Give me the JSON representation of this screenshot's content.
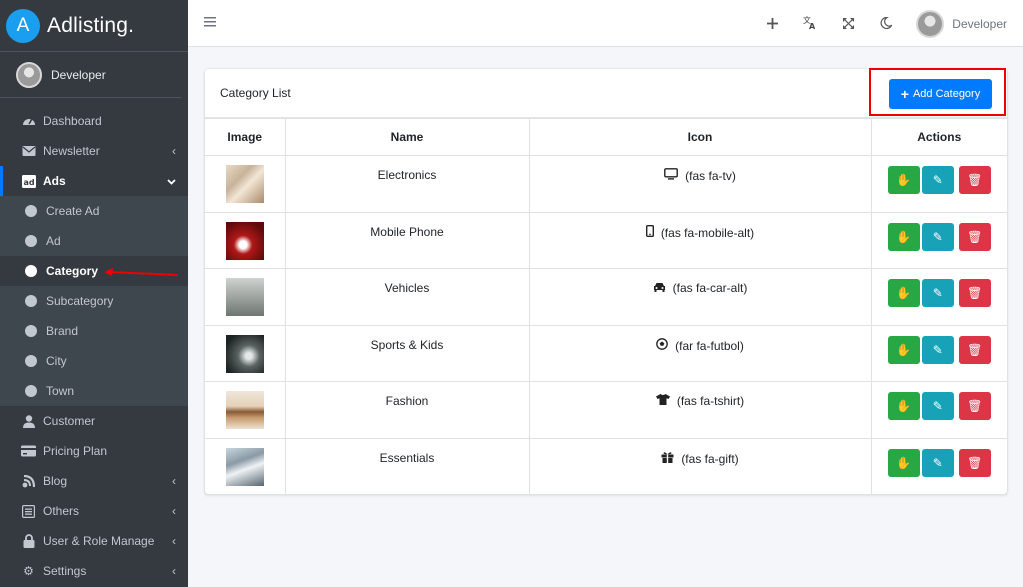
{
  "brand": {
    "logo_letter": "A",
    "name": "Adlisting."
  },
  "user": {
    "name": "Developer"
  },
  "sidebar": {
    "items": [
      {
        "label": "Dashboard",
        "icon": "tachometer-icon"
      },
      {
        "label": "Newsletter",
        "icon": "envelope-icon"
      },
      {
        "label": "Ads",
        "icon": "ad-icon"
      },
      {
        "label": "Customer",
        "icon": "user-icon"
      },
      {
        "label": "Pricing Plan",
        "icon": "credit-card-icon"
      },
      {
        "label": "Blog",
        "icon": "blog-icon"
      },
      {
        "label": "Others",
        "icon": "list-icon"
      },
      {
        "label": "User & Role Manage",
        "icon": "lock-icon"
      },
      {
        "label": "Settings",
        "icon": "cog-icon"
      }
    ],
    "ads_submenu": [
      "Create Ad",
      "Ad",
      "Category",
      "Subcategory",
      "Brand",
      "City",
      "Town"
    ],
    "active_item": "Category"
  },
  "topbar": {
    "user_name": "Developer"
  },
  "card": {
    "title": "Category List",
    "add_button_label": "Add Category"
  },
  "table": {
    "headers": [
      "Image",
      "Name",
      "Icon",
      "Actions"
    ],
    "rows": [
      {
        "name": "Electronics",
        "icon_class": "(fas fa-tv)",
        "icon": "tv-icon"
      },
      {
        "name": "Mobile Phone",
        "icon_class": "(fas fa-mobile-alt)",
        "icon": "mobile-icon"
      },
      {
        "name": "Vehicles",
        "icon_class": "(fas fa-car-alt)",
        "icon": "car-icon"
      },
      {
        "name": "Sports & Kids",
        "icon_class": "(far fa-futbol)",
        "icon": "futbol-icon"
      },
      {
        "name": "Fashion",
        "icon_class": "(fas fa-tshirt)",
        "icon": "tshirt-icon"
      },
      {
        "name": "Essentials",
        "icon_class": "(fas fa-gift)",
        "icon": "gift-icon"
      }
    ]
  },
  "colors": {
    "sidebar_bg": "#343a40",
    "primary": "#007bff",
    "success": "#28a745",
    "info": "#17a2b8",
    "danger": "#dc3545",
    "annotation_red": "#e00000"
  }
}
